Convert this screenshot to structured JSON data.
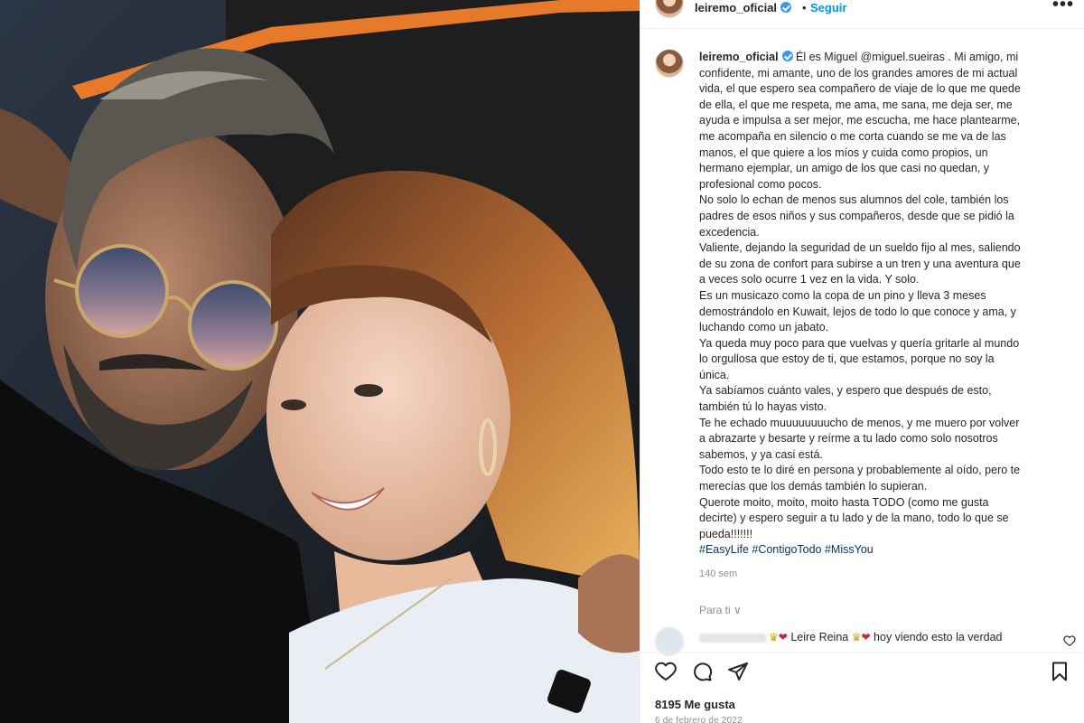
{
  "post": {
    "username": "leiremo_oficial",
    "follow_label": "Seguir",
    "more_label": "•••",
    "photo_alt": "Selfie de pareja"
  },
  "caption": {
    "username": "leiremo_oficial",
    "lines": [
      "Él es Miguel @miguel.sueiras . Mi amigo, mi",
      "confidente, mi amante, uno de los grandes amores de mi actual",
      "vida, el que espero sea compañero de viaje de lo que me quede",
      "de ella, el que me respeta, me ama, me sana, me deja ser, me",
      "ayuda e impulsa a ser mejor, me escucha, me hace plantearme,",
      "me acompaña en silencio o me corta cuando se me va de las",
      "manos, el que quiere a los míos y cuida como propios, un",
      "hermano ejemplar, un amigo de los que casi no quedan, y",
      "profesional como pocos.",
      "No solo lo echan de menos sus alumnos del cole, también los",
      "padres de esos niños y sus compañeros, desde que se pidió la",
      "excedencia.",
      "Valiente, dejando la seguridad de un sueldo fijo al mes, saliendo",
      "de su zona de confort para subirse a un tren y una aventura que",
      "a veces solo ocurre 1 vez en la vida. Y solo.",
      "Es un musicazo como la copa de un pino y lleva 3 meses",
      "demostrándolo en Kuwait, lejos de todo lo que conoce y ama, y",
      "luchando como un jabato.",
      "Ya queda muy poco para que vuelvas y quería gritarle al mundo",
      "lo orgullosa que estoy de ti, que estamos, porque no soy la",
      "única.",
      "Ya sabíamos cuánto vales, y espero que después de esto,",
      "también tú lo hayas visto.",
      "Te he echado muuuuuuuucho de menos, y me muero por volver",
      "a abrazarte y besarte y reírme a tu lado como solo nosotros",
      "sabemos, y ya casi está.",
      "Todo esto te lo diré en persona y probablemente al oído, pero te",
      "merecías que los demás también lo supieran.",
      "Querote moito, moito, moito hasta TODO (como me gusta",
      "decirte) y espero seguir a tu lado y de la mano, todo lo que se",
      "pueda!!!!!!!"
    ],
    "hashtags": "#EasyLife #ContigoTodo #MissYou",
    "time_ago": "140 sem"
  },
  "for_you": "Para ti ∨",
  "comment": {
    "text_a": "Leire Reina",
    "text_b": "hoy viendo esto la verdad"
  },
  "actions": {
    "like_icon": "heart-icon",
    "comment_icon": "comment-icon",
    "share_icon": "share-icon",
    "save_icon": "bookmark-icon"
  },
  "likes": "8195 Me gusta",
  "date": "6 de febrero de 2022",
  "colors": {
    "link_blue": "#0095f6",
    "text": "#262626",
    "muted": "#8e8e8e",
    "hashtag": "#00376b"
  }
}
